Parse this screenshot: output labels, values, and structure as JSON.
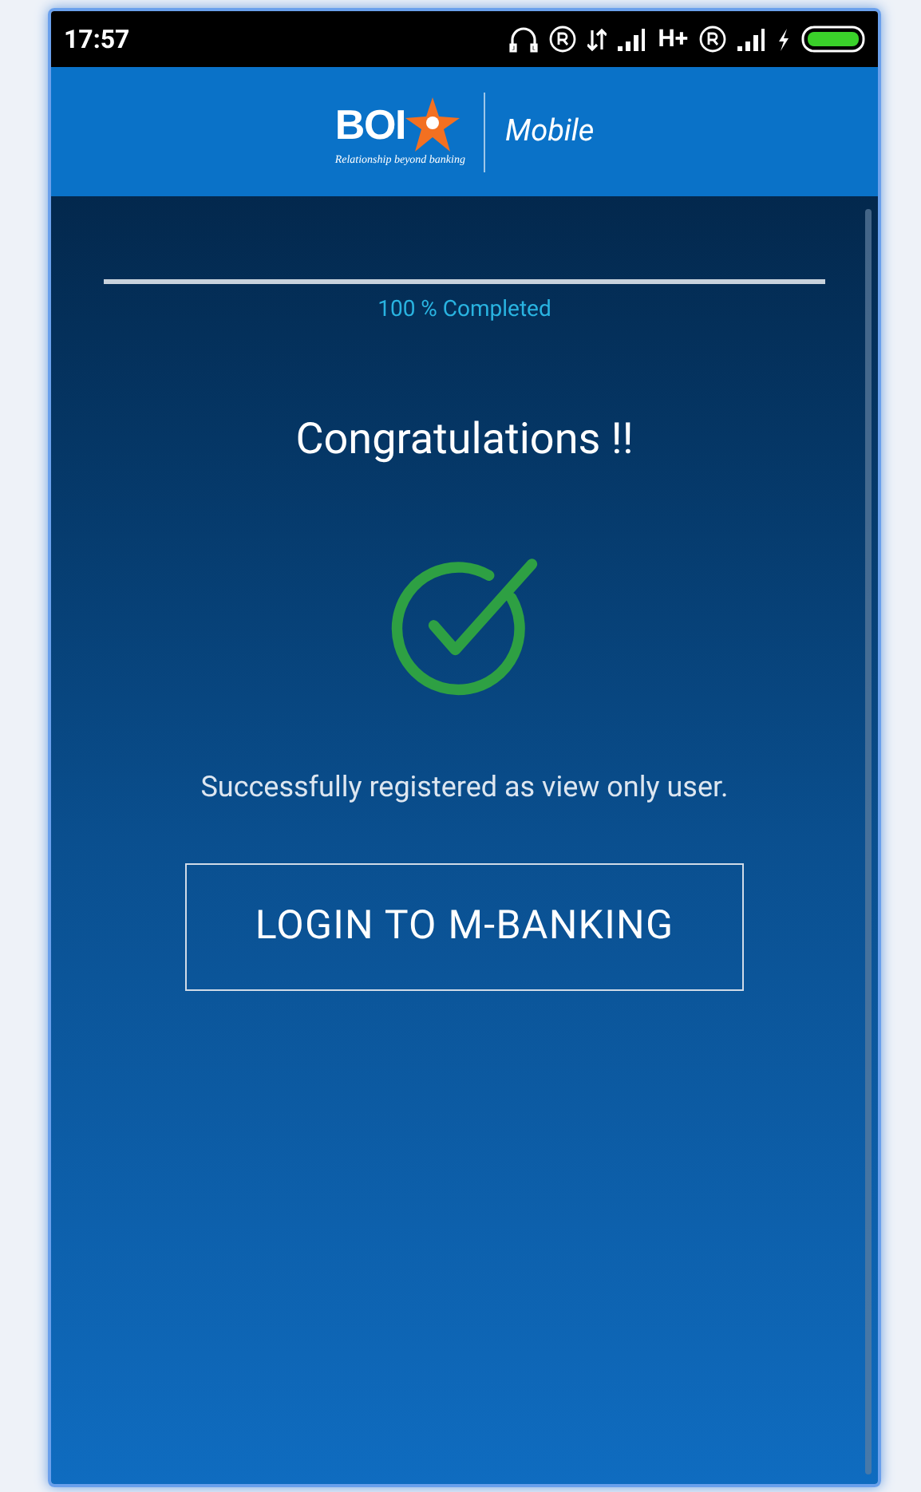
{
  "status_bar": {
    "time": "17:57",
    "network": "H+"
  },
  "header": {
    "logo_text": "BOI",
    "tagline": "Relationship beyond banking",
    "app_name": "Mobile"
  },
  "progress": {
    "level": 1,
    "label": "100 % Completed"
  },
  "title": "Congratulations !!",
  "message": "Successfully registered as view only user.",
  "button": {
    "label": "LOGIN TO M-BANKING"
  }
}
